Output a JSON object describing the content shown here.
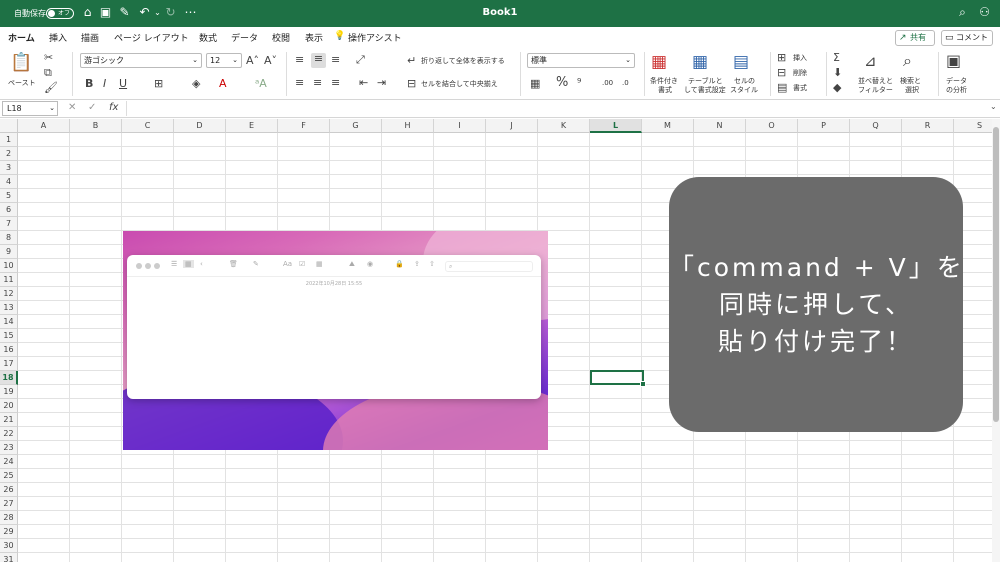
{
  "titlebar": {
    "autosave_label": "自動保存",
    "autosave_state": "オフ",
    "title": "Book1"
  },
  "tabs": [
    "ホーム",
    "挿入",
    "描画",
    "ページ レイアウト",
    "数式",
    "データ",
    "校閲",
    "表示"
  ],
  "tell_me": "操作アシスト",
  "share_label": "共有",
  "comment_label": "コメント",
  "ribbon": {
    "paste_label": "ペースト",
    "font_name": "游ゴシック",
    "font_size": "12",
    "wrap_text": "折り返して全体を表示する",
    "merge_center": "セルを結合して中央揃え",
    "number_format": "標準",
    "conditional_format": [
      "条件付き",
      "書式"
    ],
    "format_as_table": [
      "テーブルと",
      "して書式設定"
    ],
    "cell_styles": [
      "セルの",
      "スタイル"
    ],
    "insert": "挿入",
    "delete": "削除",
    "format": "書式",
    "sort_filter": [
      "並べ替えと",
      "フィルター"
    ],
    "find_select": [
      "検索と",
      "選択"
    ],
    "analyze_data": [
      "データ",
      "の分析"
    ]
  },
  "formula_bar": {
    "name_box": "L18",
    "fx": "fx",
    "value": ""
  },
  "columns": [
    "A",
    "B",
    "C",
    "D",
    "E",
    "F",
    "G",
    "H",
    "I",
    "J",
    "K",
    "L",
    "M",
    "N",
    "O",
    "P",
    "Q",
    "R",
    "S"
  ],
  "selected_column": "L",
  "rows": [
    "1",
    "2",
    "3",
    "4",
    "5",
    "6",
    "7",
    "8",
    "9",
    "10",
    "11",
    "12",
    "13",
    "14",
    "15",
    "16",
    "17",
    "18",
    "19",
    "20",
    "21",
    "22",
    "23",
    "24",
    "25",
    "26",
    "27",
    "28",
    "29",
    "30",
    "31"
  ],
  "selected_row": "18",
  "pasted_image": {
    "date_text": "2022年10月28日 15:55"
  },
  "callout": {
    "lines": [
      "「command + V」を",
      "同時に押して、",
      "貼り付け完了！"
    ],
    "bg_color": "#6b6b6b"
  },
  "colors": {
    "brand": "#1e7145"
  }
}
